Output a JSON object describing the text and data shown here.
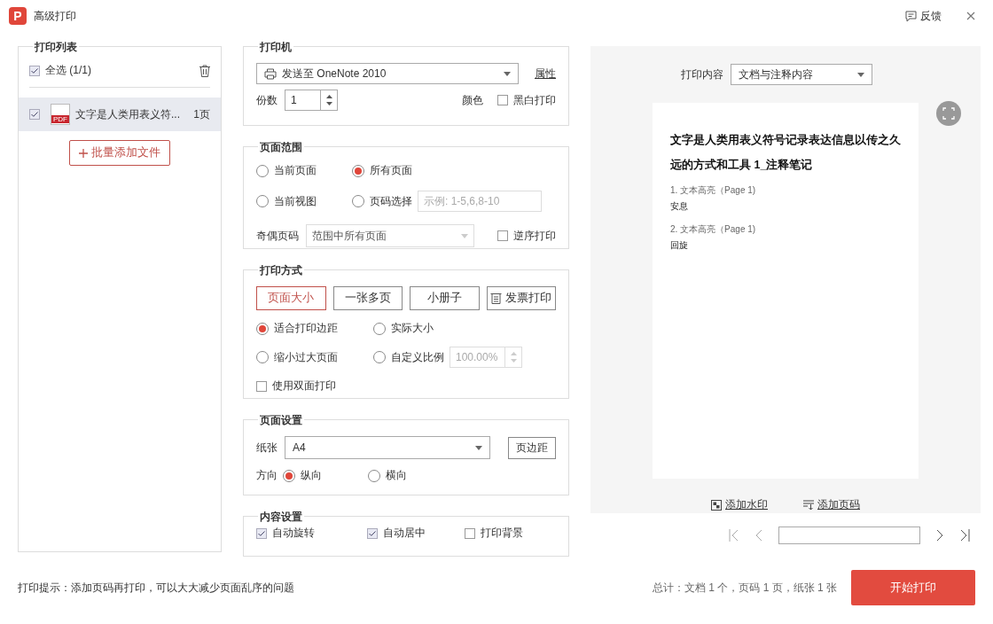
{
  "window": {
    "logo": "P",
    "title": "高级打印",
    "feedback": "反馈"
  },
  "print_list": {
    "title": "打印列表",
    "select_all": {
      "label": "全选 (1/1)",
      "checked": true
    },
    "files": [
      {
        "type_label": "PDF",
        "name": "文字是人类用表义符...",
        "pages": "1页",
        "checked": true,
        "selected": true
      }
    ],
    "add_button": "批量添加文件"
  },
  "printer": {
    "title": "打印机",
    "name": "发送至 OneNote 2010",
    "properties": "属性",
    "copies_label": "份数",
    "copies": "1",
    "color_label": "颜色",
    "black_white": {
      "label": "黑白打印",
      "checked": false
    }
  },
  "page_range": {
    "title": "页面范围",
    "options": [
      {
        "label": "当前页面",
        "selected": false
      },
      {
        "label": "所有页面",
        "selected": true
      },
      {
        "label": "当前视图",
        "selected": false
      },
      {
        "label": "页码选择",
        "selected": false
      }
    ],
    "page_input_placeholder": "示例: 1-5,6,8-10",
    "odd_even_label": "奇偶页码",
    "odd_even_value": "范围中所有页面",
    "reverse": {
      "label": "逆序打印",
      "checked": false
    }
  },
  "print_mode": {
    "title": "打印方式",
    "modes": [
      {
        "label": "页面大小",
        "selected": true,
        "kind": "text"
      },
      {
        "label": "一张多页",
        "selected": false,
        "kind": "text"
      },
      {
        "label": "小册子",
        "selected": false,
        "kind": "text"
      },
      {
        "label": "发票打印",
        "selected": false,
        "kind": "icon"
      }
    ],
    "scaling": [
      {
        "label": "适合打印边距",
        "selected": true
      },
      {
        "label": "实际大小",
        "selected": false
      },
      {
        "label": "缩小过大页面",
        "selected": false
      },
      {
        "label": "自定义比例",
        "selected": false
      }
    ],
    "scale_value": "100.00%",
    "duplex": {
      "label": "使用双面打印",
      "checked": false
    }
  },
  "page_setup": {
    "title": "页面设置",
    "paper_label": "纸张",
    "paper": "A4",
    "margins_button": "页边距",
    "orientation_label": "方向",
    "orientations": [
      {
        "label": "纵向",
        "selected": true
      },
      {
        "label": "横向",
        "selected": false
      }
    ]
  },
  "content_settings": {
    "title": "内容设置",
    "options": [
      {
        "label": "自动旋转",
        "checked": true
      },
      {
        "label": "自动居中",
        "checked": true
      },
      {
        "label": "打印背景",
        "checked": false
      }
    ]
  },
  "preview": {
    "content_label": "打印内容",
    "content_value": "文档与注释内容",
    "page": {
      "title": "文字是人类用表义符号记录表达信息以传之久远的方式和工具 1_注释笔记",
      "notes": [
        {
          "heading": "1. 文本高亮（Page 1)",
          "text": "安息"
        },
        {
          "heading": "2. 文本高亮（Page 1)",
          "text": "回旋"
        }
      ]
    },
    "add_watermark": "添加水印",
    "add_page_number": "添加页码"
  },
  "footer": {
    "tip": "打印提示：添加页码再打印，可以大大减少页面乱序的问题",
    "summary": "总计：文档 1 个，页码 1 页，纸张 1 张",
    "start_button": "开始打印"
  }
}
